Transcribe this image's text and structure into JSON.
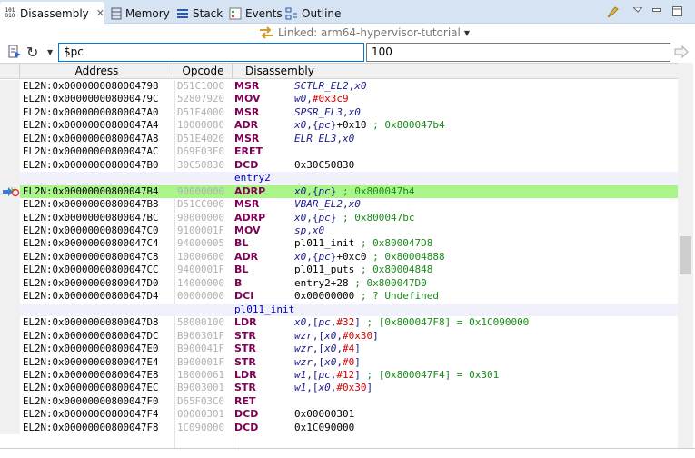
{
  "tabs": [
    {
      "label": "Disassembly",
      "icon": "disassembly-icon",
      "active": true
    },
    {
      "label": "Memory",
      "icon": "memory-icon"
    },
    {
      "label": "Stack",
      "icon": "stack-icon"
    },
    {
      "label": "Events",
      "icon": "events-icon"
    },
    {
      "label": "Outline",
      "icon": "outline-icon"
    }
  ],
  "linked": {
    "label": "Linked: arm64-hypervisor-tutorial"
  },
  "toolbar": {
    "address_input": "$pc",
    "count_input": "100"
  },
  "columns": [
    "Address",
    "Opcode",
    "Disassembly"
  ],
  "colors": {
    "mnemonic": "#7f0055",
    "register": "#1a1a8c",
    "immediate": "#d00000",
    "comment": "#1a8a1a",
    "label": "#0000c0",
    "current_line": "#aaf589"
  },
  "scroll": {
    "position_fraction": 0.5,
    "visible_fraction": 0.1
  },
  "rows": [
    {
      "addr": "EL2N:0x0000000080004798",
      "op": "D51C1000",
      "mn": "MSR",
      "ops": [
        [
          "r",
          "SCTLR_EL2"
        ],
        [
          "p",
          ","
        ],
        [
          "r",
          "x0"
        ]
      ]
    },
    {
      "addr": "EL2N:0x000000008000479C",
      "op": "52807920",
      "mn": "MOV",
      "ops": [
        [
          "r",
          "w0"
        ],
        [
          "p",
          ","
        ],
        [
          "n",
          "#0x3c9"
        ]
      ]
    },
    {
      "addr": "EL2N:0x00000000800047A0",
      "op": "D51E4000",
      "mn": "MSR",
      "ops": [
        [
          "r",
          "SPSR_EL3"
        ],
        [
          "p",
          ","
        ],
        [
          "r",
          "x0"
        ]
      ]
    },
    {
      "addr": "EL2N:0x00000000800047A4",
      "op": "10000080",
      "mn": "ADR",
      "ops": [
        [
          "r",
          "x0"
        ],
        [
          "p",
          ",{"
        ],
        [
          "r",
          "pc"
        ],
        [
          "p",
          "}"
        ],
        [
          "t",
          "+0x10 "
        ],
        [
          "c",
          "; 0x800047b4"
        ]
      ]
    },
    {
      "addr": "EL2N:0x00000000800047A8",
      "op": "D51E4020",
      "mn": "MSR",
      "ops": [
        [
          "r",
          "ELR_EL3"
        ],
        [
          "p",
          ","
        ],
        [
          "r",
          "x0"
        ]
      ]
    },
    {
      "addr": "EL2N:0x00000000800047AC",
      "op": "D69F03E0",
      "mn": "ERET",
      "ops": []
    },
    {
      "addr": "EL2N:0x00000000800047B0",
      "op": "30C50830",
      "mn": "DCD",
      "ops": [
        [
          "t",
          "0x30C50830"
        ]
      ]
    },
    {
      "label": "entry2"
    },
    {
      "addr": "EL2N:0x00000000800047B4",
      "op": "90000000",
      "mn": "ADRP",
      "pc": true,
      "ops": [
        [
          "r",
          "x0"
        ],
        [
          "p",
          ",{"
        ],
        [
          "r",
          "pc"
        ],
        [
          "p",
          "} "
        ],
        [
          "c",
          "; 0x800047b4"
        ]
      ]
    },
    {
      "addr": "EL2N:0x00000000800047B8",
      "op": "D51CC000",
      "mn": "MSR",
      "ops": [
        [
          "r",
          "VBAR_EL2"
        ],
        [
          "p",
          ","
        ],
        [
          "r",
          "x0"
        ]
      ]
    },
    {
      "addr": "EL2N:0x00000000800047BC",
      "op": "90000000",
      "mn": "ADRP",
      "ops": [
        [
          "r",
          "x0"
        ],
        [
          "p",
          ",{"
        ],
        [
          "r",
          "pc"
        ],
        [
          "p",
          "} "
        ],
        [
          "c",
          "; 0x800047bc"
        ]
      ]
    },
    {
      "addr": "EL2N:0x00000000800047C0",
      "op": "9100001F",
      "mn": "MOV",
      "ops": [
        [
          "r",
          "sp"
        ],
        [
          "p",
          ","
        ],
        [
          "r",
          "x0"
        ]
      ]
    },
    {
      "addr": "EL2N:0x00000000800047C4",
      "op": "94000005",
      "mn": "BL",
      "ops": [
        [
          "t",
          "pl011_init "
        ],
        [
          "c",
          "; 0x800047D8"
        ]
      ]
    },
    {
      "addr": "EL2N:0x00000000800047C8",
      "op": "10000600",
      "mn": "ADR",
      "ops": [
        [
          "r",
          "x0"
        ],
        [
          "p",
          ",{"
        ],
        [
          "r",
          "pc"
        ],
        [
          "p",
          "}"
        ],
        [
          "t",
          "+0xc0 "
        ],
        [
          "c",
          "; 0x80004888"
        ]
      ]
    },
    {
      "addr": "EL2N:0x00000000800047CC",
      "op": "9400001F",
      "mn": "BL",
      "ops": [
        [
          "t",
          "pl011_puts "
        ],
        [
          "c",
          "; 0x80004848"
        ]
      ]
    },
    {
      "addr": "EL2N:0x00000000800047D0",
      "op": "14000000",
      "mn": "B",
      "ops": [
        [
          "t",
          "entry2+28 "
        ],
        [
          "c",
          "; 0x800047D0"
        ]
      ]
    },
    {
      "addr": "EL2N:0x00000000800047D4",
      "op": "00000000",
      "mn": "DCI",
      "ops": [
        [
          "t",
          "0x00000000 "
        ],
        [
          "c",
          "; ? Undefined"
        ]
      ]
    },
    {
      "label": "pl011_init"
    },
    {
      "addr": "EL2N:0x00000000800047D8",
      "op": "58000100",
      "mn": "LDR",
      "ops": [
        [
          "r",
          "x0"
        ],
        [
          "p",
          ",["
        ],
        [
          "r",
          "pc"
        ],
        [
          "p",
          ","
        ],
        [
          "n",
          "#32"
        ],
        [
          "p",
          "] "
        ],
        [
          "c",
          "; [0x800047F8] = 0x1C090000"
        ]
      ]
    },
    {
      "addr": "EL2N:0x00000000800047DC",
      "op": "B900301F",
      "mn": "STR",
      "ops": [
        [
          "r",
          "wzr"
        ],
        [
          "p",
          ",["
        ],
        [
          "r",
          "x0"
        ],
        [
          "p",
          ","
        ],
        [
          "n",
          "#0x30"
        ],
        [
          "p",
          "]"
        ]
      ]
    },
    {
      "addr": "EL2N:0x00000000800047E0",
      "op": "B900041F",
      "mn": "STR",
      "ops": [
        [
          "r",
          "wzr"
        ],
        [
          "p",
          ",["
        ],
        [
          "r",
          "x0"
        ],
        [
          "p",
          ","
        ],
        [
          "n",
          "#4"
        ],
        [
          "p",
          "]"
        ]
      ]
    },
    {
      "addr": "EL2N:0x00000000800047E4",
      "op": "B900001F",
      "mn": "STR",
      "ops": [
        [
          "r",
          "wzr"
        ],
        [
          "p",
          ",["
        ],
        [
          "r",
          "x0"
        ],
        [
          "p",
          ","
        ],
        [
          "n",
          "#0"
        ],
        [
          "p",
          "]"
        ]
      ]
    },
    {
      "addr": "EL2N:0x00000000800047E8",
      "op": "18000061",
      "mn": "LDR",
      "ops": [
        [
          "r",
          "w1"
        ],
        [
          "p",
          ",["
        ],
        [
          "r",
          "pc"
        ],
        [
          "p",
          ","
        ],
        [
          "n",
          "#12"
        ],
        [
          "p",
          "] "
        ],
        [
          "c",
          "; [0x800047F4] = 0x301"
        ]
      ]
    },
    {
      "addr": "EL2N:0x00000000800047EC",
      "op": "B9003001",
      "mn": "STR",
      "ops": [
        [
          "r",
          "w1"
        ],
        [
          "p",
          ",["
        ],
        [
          "r",
          "x0"
        ],
        [
          "p",
          ","
        ],
        [
          "n",
          "#0x30"
        ],
        [
          "p",
          "]"
        ]
      ]
    },
    {
      "addr": "EL2N:0x00000000800047F0",
      "op": "D65F03C0",
      "mn": "RET",
      "ops": []
    },
    {
      "addr": "EL2N:0x00000000800047F4",
      "op": "00000301",
      "mn": "DCD",
      "ops": [
        [
          "t",
          "0x00000301"
        ]
      ]
    },
    {
      "addr": "EL2N:0x00000000800047F8",
      "op": "1C090000",
      "mn": "DCD",
      "ops": [
        [
          "t",
          "0x1C090000"
        ]
      ]
    }
  ]
}
